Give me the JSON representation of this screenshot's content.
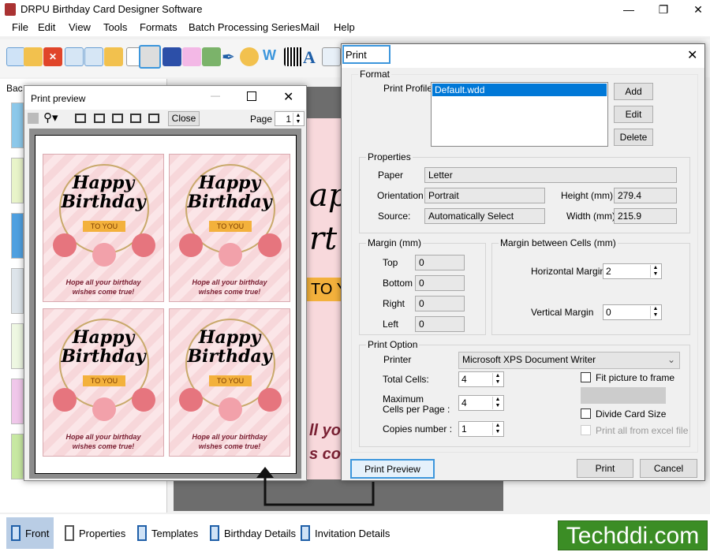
{
  "app": {
    "title": "DRPU Birthday Card Designer Software"
  },
  "menu": [
    "File",
    "Edit",
    "View",
    "Tools",
    "Formats",
    "Batch Processing Series",
    "Mail",
    "Help"
  ],
  "toolbar": {
    "icons": [
      "new-icon",
      "open-icon",
      "close-icon",
      "save-icon",
      "save-as-icon",
      "export-icon",
      "properties-icon",
      "print-icon",
      "background-icon",
      "gift-icon",
      "image-icon",
      "pen-icon",
      "shapes-icon",
      "wordart-icon",
      "barcode-icon",
      "text-icon",
      "text-style-icon"
    ]
  },
  "left_panel": {
    "tab": "Bac"
  },
  "preview": {
    "title": "Print preview",
    "close": "Close",
    "page_label": "Page",
    "page": "1",
    "card": {
      "line1": "Happy",
      "line2": "Birthday",
      "ribbon": "TO YOU",
      "message1": "Hope all your birthday",
      "message2": "wishes come true!"
    }
  },
  "canvas_card": {
    "t1": "ap",
    "t2": "rt",
    "t3": "TO Y",
    "t4": "ll you",
    "t5": "s co"
  },
  "dialog": {
    "title": "Print",
    "format": {
      "label": "Format",
      "profile_label": "Print Profile",
      "profiles": [
        "Default.wdd"
      ],
      "add": "Add",
      "edit": "Edit",
      "delete": "Delete"
    },
    "properties": {
      "label": "Properties",
      "paper_label": "Paper",
      "paper": "Letter",
      "orientation_label": "Orientation",
      "orientation": "Portrait",
      "source_label": "Source:",
      "source": "Automatically Select",
      "height_label": "Height (mm)",
      "height": "279.4",
      "width_label": "Width (mm)",
      "width": "215.9"
    },
    "margin": {
      "label": "Margin (mm)",
      "top_label": "Top",
      "top": "0",
      "bottom_label": "Bottom",
      "bottom": "0",
      "right_label": "Right",
      "right": "0",
      "left_label": "Left",
      "left": "0"
    },
    "cell_margin": {
      "label": "Margin between Cells (mm)",
      "h_label": "Horizontal Margin",
      "h": "2",
      "v_label": "Vertical Margin",
      "v": "0"
    },
    "print_option": {
      "label": "Print Option",
      "printer_label": "Printer",
      "printer": "Microsoft XPS Document Writer",
      "total_label": "Total Cells:",
      "total": "4",
      "max_label1": "Maximum",
      "max_label2": "Cells per Page :",
      "max": "4",
      "copies_label": "Copies number :",
      "copies": "1",
      "fit": "Fit picture to frame",
      "fit_checked": false,
      "divide": "Divide Card Size",
      "divide_checked": false,
      "excel": "Print all from excel file",
      "excel_checked": false
    },
    "preview_btn": "Print Preview",
    "print_btn": "Print",
    "cancel_btn": "Cancel"
  },
  "bottom_tabs": [
    "Front",
    "Properties",
    "Templates",
    "Birthday Details",
    "Invitation Details"
  ],
  "watermark": "Techddi.com",
  "colors": {
    "accent": "#0078d7",
    "highlight": "#3c96dc",
    "logo": "#3b8d25"
  }
}
